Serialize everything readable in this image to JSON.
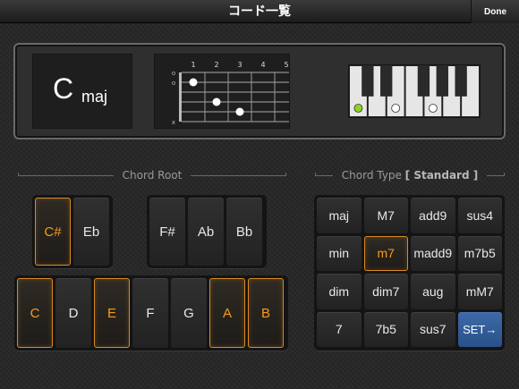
{
  "header": {
    "title": "コード一覧",
    "done_label": "Done"
  },
  "display": {
    "chord_root": "C",
    "chord_type": "maj",
    "fretboard": {
      "fret_numbers": [
        "1",
        "2",
        "3",
        "4",
        "5"
      ],
      "string_markers": [
        "o",
        "o",
        "",
        "",
        "",
        "x"
      ],
      "dots": [
        {
          "string": 2,
          "fret": 1
        },
        {
          "string": 4,
          "fret": 2
        },
        {
          "string": 5,
          "fret": 3
        }
      ]
    },
    "keyboard": {
      "white_keys": 7,
      "root_key_index": 0,
      "highlighted_keys": [
        0,
        2,
        4
      ],
      "root_color": "#8fd321",
      "highlight_color": "#ffffff"
    }
  },
  "chord_root": {
    "label": "Chord Root",
    "sharp_flat_left": [
      {
        "label": "C#",
        "selected": true
      },
      {
        "label": "Eb",
        "selected": false
      }
    ],
    "sharp_flat_right": [
      {
        "label": "F#",
        "selected": false
      },
      {
        "label": "Ab",
        "selected": false
      },
      {
        "label": "Bb",
        "selected": false
      }
    ],
    "naturals": [
      {
        "label": "C",
        "selected": true
      },
      {
        "label": "D",
        "selected": false
      },
      {
        "label": "E",
        "selected": true
      },
      {
        "label": "F",
        "selected": false
      },
      {
        "label": "G",
        "selected": false
      },
      {
        "label": "A",
        "selected": true
      },
      {
        "label": "B",
        "selected": true
      }
    ]
  },
  "chord_type": {
    "label": "Chord Type",
    "mode": "[ Standard ]",
    "rows": [
      [
        {
          "label": "maj",
          "selected": false
        },
        {
          "label": "M7",
          "selected": false
        },
        {
          "label": "add9",
          "selected": false
        },
        {
          "label": "sus4",
          "selected": false
        }
      ],
      [
        {
          "label": "min",
          "selected": false
        },
        {
          "label": "m7",
          "selected": true
        },
        {
          "label": "madd9",
          "selected": false
        },
        {
          "label": "m7b5",
          "selected": false
        }
      ],
      [
        {
          "label": "dim",
          "selected": false
        },
        {
          "label": "dim7",
          "selected": false
        },
        {
          "label": "aug",
          "selected": false
        },
        {
          "label": "mM7",
          "selected": false
        }
      ],
      [
        {
          "label": "7",
          "selected": false
        },
        {
          "label": "7b5",
          "selected": false
        },
        {
          "label": "sus7",
          "selected": false
        },
        {
          "label": "SET",
          "selected": false,
          "action": true,
          "icon": "arrow-right-icon",
          "color": "#3b66a4"
        }
      ]
    ]
  }
}
